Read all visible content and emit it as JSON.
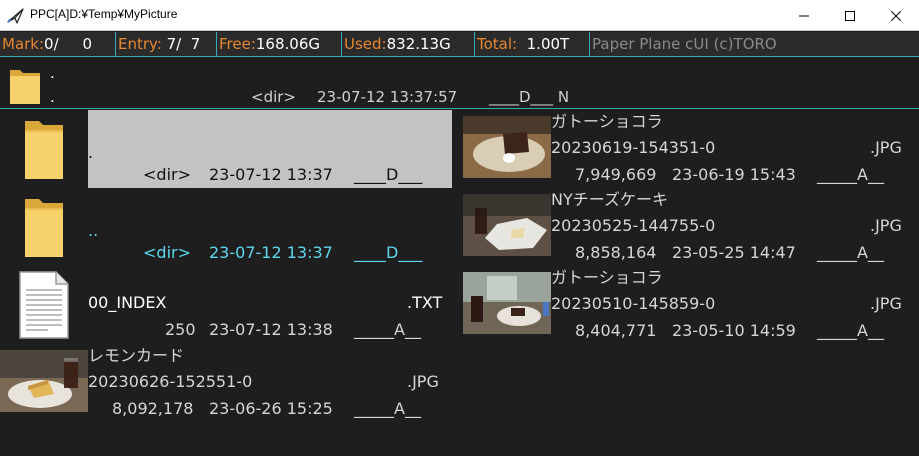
{
  "window": {
    "title": "PPC[A]D:¥Temp¥MyPicture"
  },
  "infobar": {
    "mark_label": "Mark:",
    "mark_value": "0/     0",
    "entry_label": "Entry:",
    "entry_value": " 7/  7",
    "free_label": "Free:",
    "free_value": "168.06G",
    "used_label": "Used:",
    "used_value": "832.13G",
    "total_label": "Total:",
    "total_value": "  1.00T",
    "credit": "Paper Plane cUI (c)TORO"
  },
  "current_dir": {
    "name_top": ".",
    "name_bottom": ".",
    "type": "<dir>",
    "datetime": "23-07-12 13:37:57",
    "attrs": "____D___ N"
  },
  "entries": [
    {
      "name": ".",
      "ext": "",
      "size": "<dir>",
      "datetime": "23-07-12 13:37",
      "attrs": "____D___",
      "icon": "folder-icon",
      "state": "cursor"
    },
    {
      "name": "..",
      "ext": "",
      "size": "<dir>",
      "datetime": "23-07-12 13:37",
      "attrs": "____D___",
      "icon": "folder-icon",
      "state": "cyan"
    },
    {
      "name": "00_INDEX",
      "ext": ".TXT",
      "size": "250",
      "datetime": "23-07-12 13:38",
      "attrs": "_____A__",
      "icon": "text-file-icon",
      "state": "white"
    },
    {
      "caption": "レモンカード",
      "name": "20230626-152551-0",
      "ext": ".JPG",
      "size": "8,092,178",
      "datetime": "23-06-26 15:25",
      "attrs": "_____A__",
      "icon": "photo-thumbnail-lemon-curd"
    },
    {
      "caption": "ガトーショコラ",
      "name": "20230619-154351-0",
      "ext": ".JPG",
      "size": "7,949,669",
      "datetime": "23-06-19 15:43",
      "attrs": "_____A__",
      "icon": "photo-thumbnail-gateau-chocolat"
    },
    {
      "caption": "NYチーズケーキ",
      "name": "20230525-144755-0",
      "ext": ".JPG",
      "size": "8,858,164",
      "datetime": "23-05-25 14:47",
      "attrs": "_____A__",
      "icon": "photo-thumbnail-ny-cheesecake"
    },
    {
      "caption": "ガトーショコラ",
      "name": "20230510-145859-0",
      "ext": ".JPG",
      "size": "8,404,771",
      "datetime": "23-05-10 14:59",
      "attrs": "_____A__",
      "icon": "photo-thumbnail-gateau-chocolat-2"
    }
  ],
  "colors": {
    "background": "#1e1e1e",
    "label_orange": "#e8872e",
    "divider_cyan": "#3aaab8",
    "cursor_bg": "#c3c3c3",
    "highlight_cyan": "#5ed8ee"
  }
}
